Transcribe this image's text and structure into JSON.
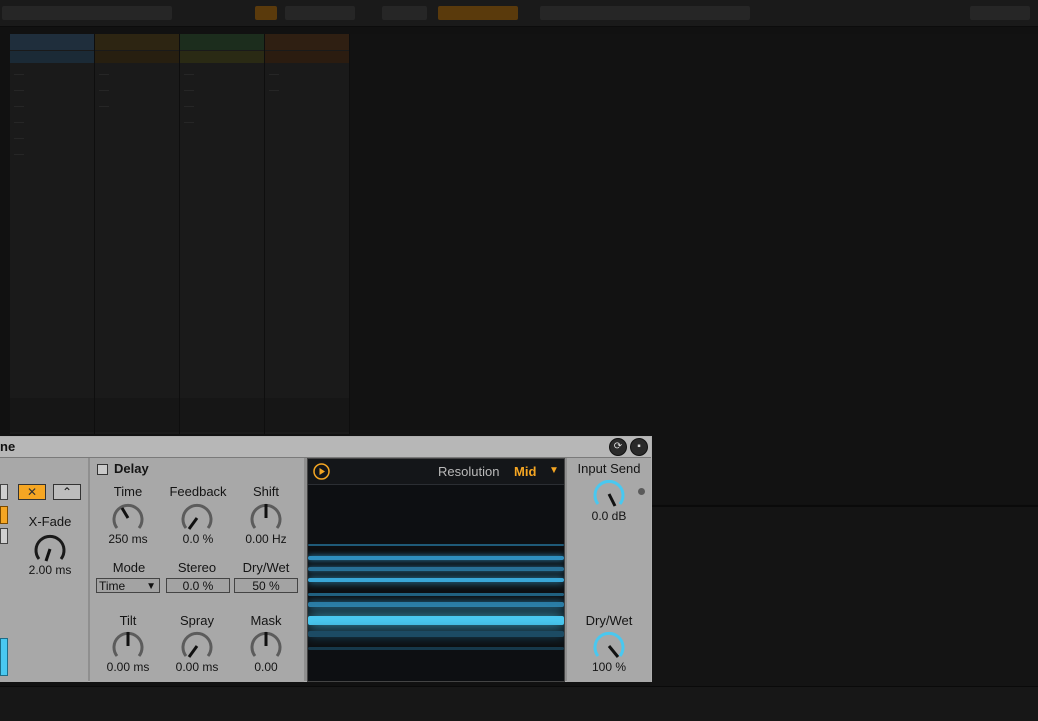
{
  "device": {
    "title_partial": "ne",
    "xfade_label": "X-Fade",
    "xfade_value": "2.00 ms",
    "delay": {
      "toggle_label": "Delay",
      "time_label": "Time",
      "time_value": "250 ms",
      "feedback_label": "Feedback",
      "feedback_value": "0.0 %",
      "shift_label": "Shift",
      "shift_value": "0.00 Hz",
      "mode_label": "Mode",
      "mode_value": "Time",
      "stereo_label": "Stereo",
      "stereo_value": "0.0 %",
      "drywet_label": "Dry/Wet",
      "drywet_value": "50 %",
      "tilt_label": "Tilt",
      "tilt_value": "0.00 ms",
      "spray_label": "Spray",
      "spray_value": "0.00 ms",
      "mask_label": "Mask",
      "mask_value": "0.00"
    },
    "display": {
      "resolution_label": "Resolution",
      "resolution_value": "Mid"
    },
    "input_send_label": "Input Send",
    "input_send_value": "0.0 dB",
    "main_drywet_label": "Dry/Wet",
    "main_drywet_value": "100 %"
  },
  "colors": {
    "accent_orange": "#f5a623",
    "accent_cyan": "#49c8f0",
    "device_bg": "#a8a8a8",
    "display_bg": "#0d0f12"
  },
  "icons": {
    "play": "play-icon",
    "hot_swap": "hot-swap-icon",
    "save_preset": "save-icon",
    "dropdown": "chevron-down-icon"
  }
}
